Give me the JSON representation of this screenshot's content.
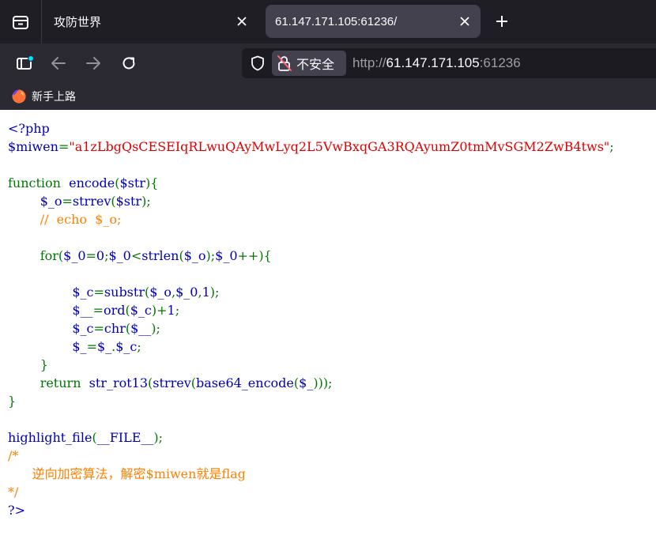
{
  "tabs": [
    {
      "title": "攻防世界",
      "active": false
    },
    {
      "title": "61.147.171.105:61236/",
      "active": true
    }
  ],
  "toolbar": {
    "security_label": "不安全",
    "url_scheme": "http://",
    "url_host": "61.147.171.105",
    "url_port": ":61236"
  },
  "bookmarks": [
    {
      "label": "新手上路",
      "icon": "firefox-icon"
    }
  ],
  "colors": {
    "html": "#0000bb",
    "keyword": "#007700",
    "string": "#dd0000",
    "comment": "#ff8000"
  },
  "code": {
    "l1": "<?php",
    "l2_var": "$miwen",
    "l2_eq": "=",
    "l2_str": "\"a1zLbgQsCESEIqRLwuQAyMwLyq2L5VwBxqGA3RQAyumZ0tmMvSGM2ZwB4tws\"",
    "l2_end": ";",
    "l4_kw": "function  ",
    "l4_def": "encode",
    "l4_p1": "(",
    "l4_arg": "$str",
    "l4_p2": "){",
    "l5_var": "$_o",
    "l5_eq": "=",
    "l5_fn": "strrev",
    "l5_p1": "(",
    "l5_arg": "$str",
    "l5_p2": ");",
    "l6_cmt": "//  echo  $_o;",
    "l8_kw": "for(",
    "l8_a": "$_0",
    "l8_b": "=",
    "l8_c": "0",
    "l8_d": ";",
    "l8_e": "$_0",
    "l8_f": "<",
    "l8_g": "strlen",
    "l8_h": "(",
    "l8_i": "$_o",
    "l8_j": ");",
    "l8_k": "$_0",
    "l8_l": "++){",
    "l10_a": "$_c",
    "l10_b": "=",
    "l10_c": "substr",
    "l10_d": "(",
    "l10_e": "$_o",
    "l10_f": ",",
    "l10_g": "$_0",
    "l10_h": ",",
    "l10_i": "1",
    "l10_j": ");",
    "l11_a": "$__",
    "l11_b": "=",
    "l11_c": "ord",
    "l11_d": "(",
    "l11_e": "$_c",
    "l11_f": ")+",
    "l11_g": "1",
    "l11_h": ";",
    "l12_a": "$_c",
    "l12_b": "=",
    "l12_c": "chr",
    "l12_d": "(",
    "l12_e": "$__",
    "l12_f": ");",
    "l13_a": "$_",
    "l13_b": "=",
    "l13_c": "$_",
    "l13_d": ".",
    "l13_e": "$_c",
    "l13_f": ";",
    "l14": "}",
    "l15_kw": "return  ",
    "l15_a": "str_rot13",
    "l15_b": "(",
    "l15_c": "strrev",
    "l15_d": "(",
    "l15_e": "base64_encode",
    "l15_f": "(",
    "l15_g": "$_",
    "l15_h": ")));",
    "l16": "}",
    "l18_a": "highlight_file",
    "l18_b": "(",
    "l18_c": "__FILE__",
    "l18_d": ");",
    "l19": "/*",
    "l20": "      逆向加密算法，解密$miwen就是flag",
    "l21": "*/",
    "l22": "?>"
  }
}
